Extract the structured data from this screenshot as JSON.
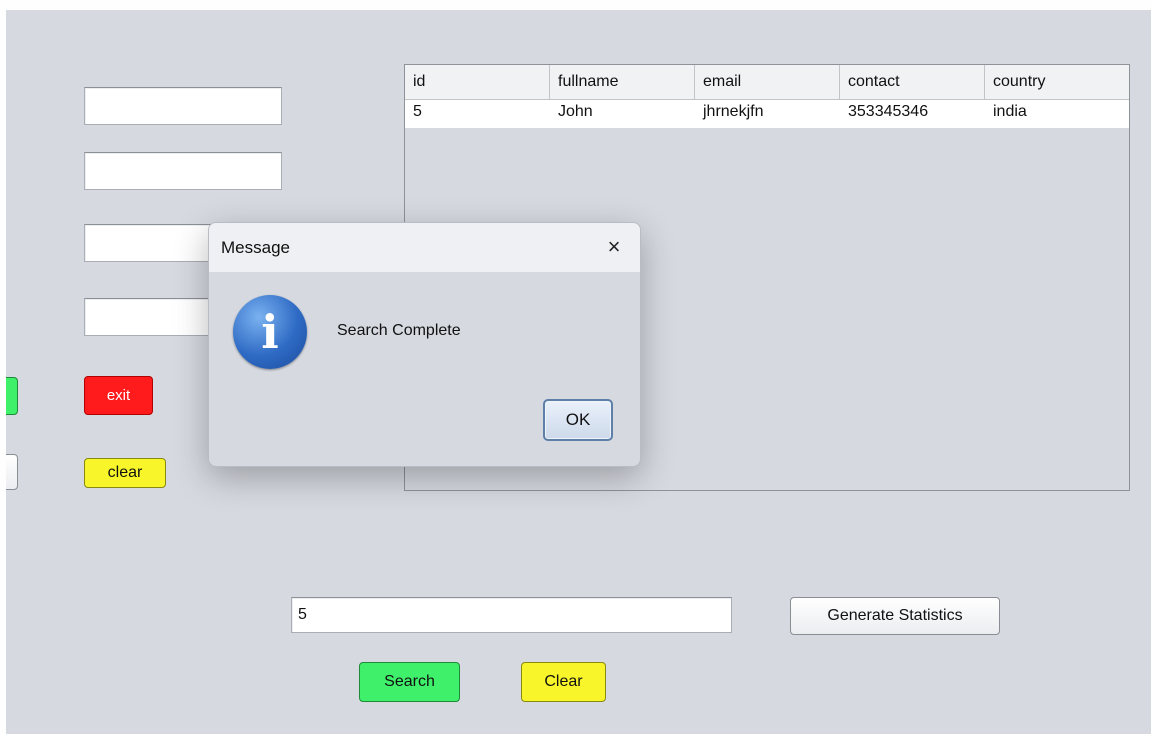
{
  "form": {
    "fields": [
      "",
      "",
      "",
      ""
    ],
    "exit_label": "exit",
    "clear_label": "clear"
  },
  "table": {
    "columns": [
      "id",
      "fullname",
      "email",
      "contact",
      "country"
    ],
    "rows": [
      [
        "5",
        "John",
        "jhrnekjfn",
        "353345346",
        "india"
      ]
    ]
  },
  "search": {
    "value": "5",
    "generate_label": "Generate Statistics",
    "search_label": "Search",
    "clear_label": "Clear"
  },
  "dialog": {
    "title": "Message",
    "close_glyph": "×",
    "icon": "info-icon",
    "icon_glyph": "i",
    "message": "Search Complete",
    "ok_label": "OK"
  },
  "colors": {
    "background": "#d6d9e0",
    "exit": "#ff1b1b",
    "clear": "#f8f62a",
    "search": "#3ff06a"
  }
}
